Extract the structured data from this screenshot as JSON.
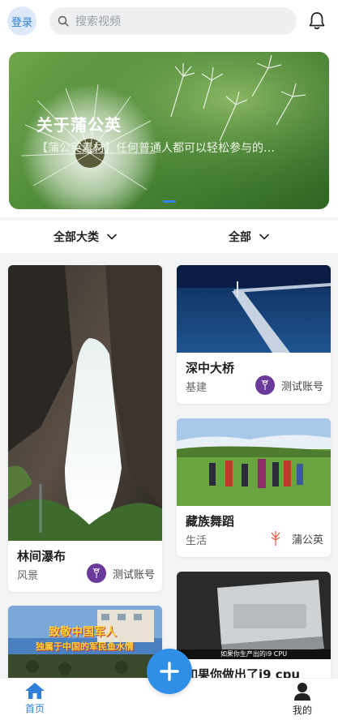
{
  "header": {
    "login_label": "登录",
    "search_placeholder": "搜索视频"
  },
  "banner": {
    "title": "关于蒲公英",
    "subtitle": "【蒲公英素材】任何普通人都可以轻松参与的…",
    "active_slide": 1,
    "slide_count": 1
  },
  "filters": {
    "category_label": "全部大类",
    "scope_label": "全部"
  },
  "feed": {
    "left": [
      {
        "title": "林间瀑布",
        "category": "风景",
        "author": "测试账号"
      },
      {
        "title": "",
        "category": "",
        "author": "",
        "thumb_caption_1": "致敬中国军人",
        "thumb_caption_2": "独属于中国的军民鱼水情"
      }
    ],
    "right": [
      {
        "title": "深中大桥",
        "category": "基建",
        "author": "测试账号"
      },
      {
        "title": "藏族舞蹈",
        "category": "生活",
        "author": "蒲公英"
      },
      {
        "title": "如果你做出了i9 cpu",
        "category": "",
        "author": "",
        "thumb_caption": "如果你生产出的i9 CPU"
      }
    ]
  },
  "nav": {
    "home_label": "首页",
    "mine_label": "我的"
  },
  "colors": {
    "accent": "#2f7fdb",
    "fab": "#2f8fe6",
    "avatar_purple": "#6a3a9a"
  }
}
